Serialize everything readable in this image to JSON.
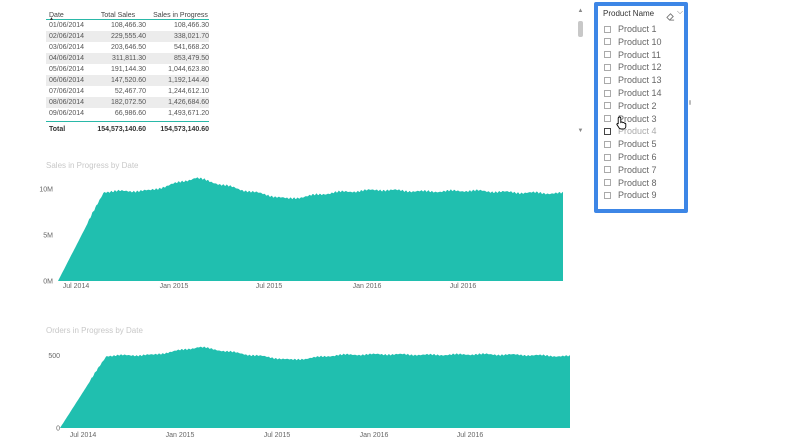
{
  "table": {
    "headers": [
      "Date",
      "Total Sales",
      "Sales in Progress"
    ],
    "rows": [
      [
        "01/06/2014",
        "108,466.30",
        "108,466.30"
      ],
      [
        "02/06/2014",
        "229,555.40",
        "338,021.70"
      ],
      [
        "03/06/2014",
        "203,646.50",
        "541,668.20"
      ],
      [
        "04/06/2014",
        "311,811.30",
        "853,479.50"
      ],
      [
        "05/06/2014",
        "191,144.30",
        "1,044,623.80"
      ],
      [
        "06/06/2014",
        "147,520.60",
        "1,192,144.40"
      ],
      [
        "07/06/2014",
        "52,467.70",
        "1,244,612.10"
      ],
      [
        "08/06/2014",
        "182,072.50",
        "1,426,684.60"
      ],
      [
        "09/06/2014",
        "66,986.60",
        "1,493,671.20"
      ]
    ],
    "total": [
      "Total",
      "154,573,140.60",
      "154,573,140.60"
    ]
  },
  "slicer": {
    "title": "Product Name",
    "items": [
      "Product 1",
      "Product 10",
      "Product 11",
      "Product 12",
      "Product 13",
      "Product 14",
      "Product 2",
      "Product 3",
      "Product 4",
      "Product 5",
      "Product 6",
      "Product 7",
      "Product 8",
      "Product 9"
    ],
    "hover_index": 8
  },
  "icons": {
    "slicer_clear": "eraser-icon",
    "slicer_menu": "chevron-down-icon",
    "cursor": "hand-pointer-icon",
    "scroll_up": "chevron-up-icon",
    "scroll_down": "chevron-down-icon"
  },
  "colors": {
    "accent": "#20bfaf",
    "slicer_border": "#3d86e6"
  },
  "chart_data": [
    {
      "type": "area",
      "title": "Sales in Progress by Date",
      "xlabel": "",
      "ylabel": "",
      "x_ticks": [
        "Jul 2014",
        "Jan 2015",
        "Jul 2015",
        "Jan 2016",
        "Jul 2016"
      ],
      "y_ticks": [
        "0M",
        "5M",
        "10M"
      ],
      "ylim": [
        0,
        11500000
      ],
      "x": [
        "2014-06",
        "2014-09",
        "2014-12",
        "2015-01",
        "2015-03",
        "2015-06",
        "2015-09",
        "2015-12",
        "2016-03",
        "2016-06",
        "2016-09",
        "2016-12"
      ],
      "values": [
        0,
        9700000,
        9800000,
        11200000,
        9900000,
        8900000,
        9600000,
        9900000,
        9700000,
        9800000,
        9600000,
        9500000
      ],
      "color": "#20bfaf",
      "grid": false
    },
    {
      "type": "area",
      "title": "Orders in Progress by Date",
      "xlabel": "",
      "ylabel": "",
      "x_ticks": [
        "Jul 2014",
        "Jan 2015",
        "Jul 2015",
        "Jan 2016",
        "Jul 2016"
      ],
      "y_ticks": [
        "0",
        "500"
      ],
      "ylim": [
        0,
        560
      ],
      "x": [
        "2014-06",
        "2014-09",
        "2014-12",
        "2015-01",
        "2015-03",
        "2015-06",
        "2015-09",
        "2015-12",
        "2016-03",
        "2016-06",
        "2016-09",
        "2016-12"
      ],
      "values": [
        0,
        500,
        505,
        560,
        510,
        470,
        505,
        510,
        505,
        510,
        505,
        495
      ],
      "color": "#20bfaf",
      "grid": false
    }
  ]
}
